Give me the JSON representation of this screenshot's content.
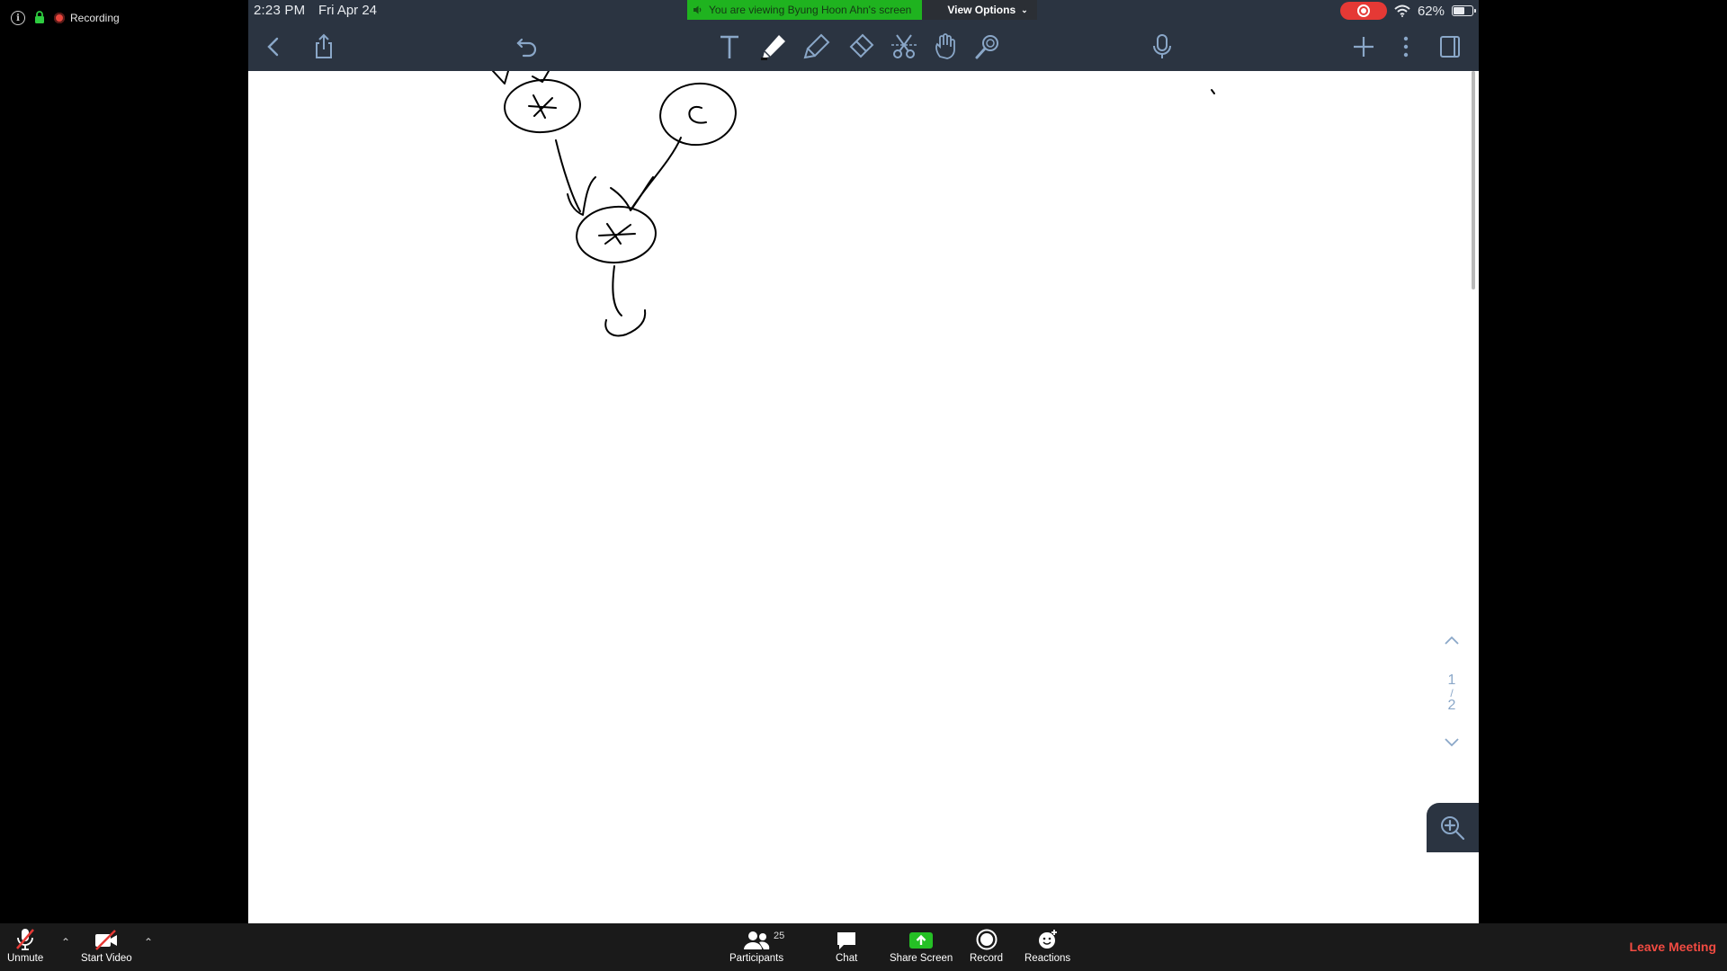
{
  "zoom_status": {
    "recording_label": "Recording"
  },
  "ipad": {
    "time": "2:23 PM",
    "date": "Fri Apr 24",
    "battery": "62%",
    "battery_level": 0.62
  },
  "banner": {
    "viewing_text": "You are viewing Byung Hoon Ahn's screen",
    "view_options": "View Options"
  },
  "notes_toolbar": {
    "left_icons": [
      "back-icon",
      "share-icon",
      "undo-icon"
    ],
    "tool_icons": [
      "text-tool-icon",
      "pen-tool-icon",
      "highlighter-icon",
      "eraser-icon",
      "lasso-scissors-icon",
      "hand-tool-icon",
      "laser-pointer-icon"
    ],
    "right_icons": [
      "microphone-icon",
      "add-icon",
      "more-icon",
      "pages-icon"
    ]
  },
  "page_nav": {
    "current": "1",
    "separator": "/",
    "total": "2"
  },
  "zoom_bar": {
    "unmute": "Unmute",
    "start_video": "Start Video",
    "participants": "Participants",
    "participants_count": "25",
    "chat": "Chat",
    "share_screen": "Share Screen",
    "record": "Record",
    "reactions": "Reactions",
    "leave": "Leave Meeting"
  },
  "colors": {
    "toolbar_bg": "#2b3441",
    "banner_green": "#1fb31f",
    "leave_red": "#f24b42",
    "share_green": "#25c025",
    "record_red": "#e53935"
  }
}
